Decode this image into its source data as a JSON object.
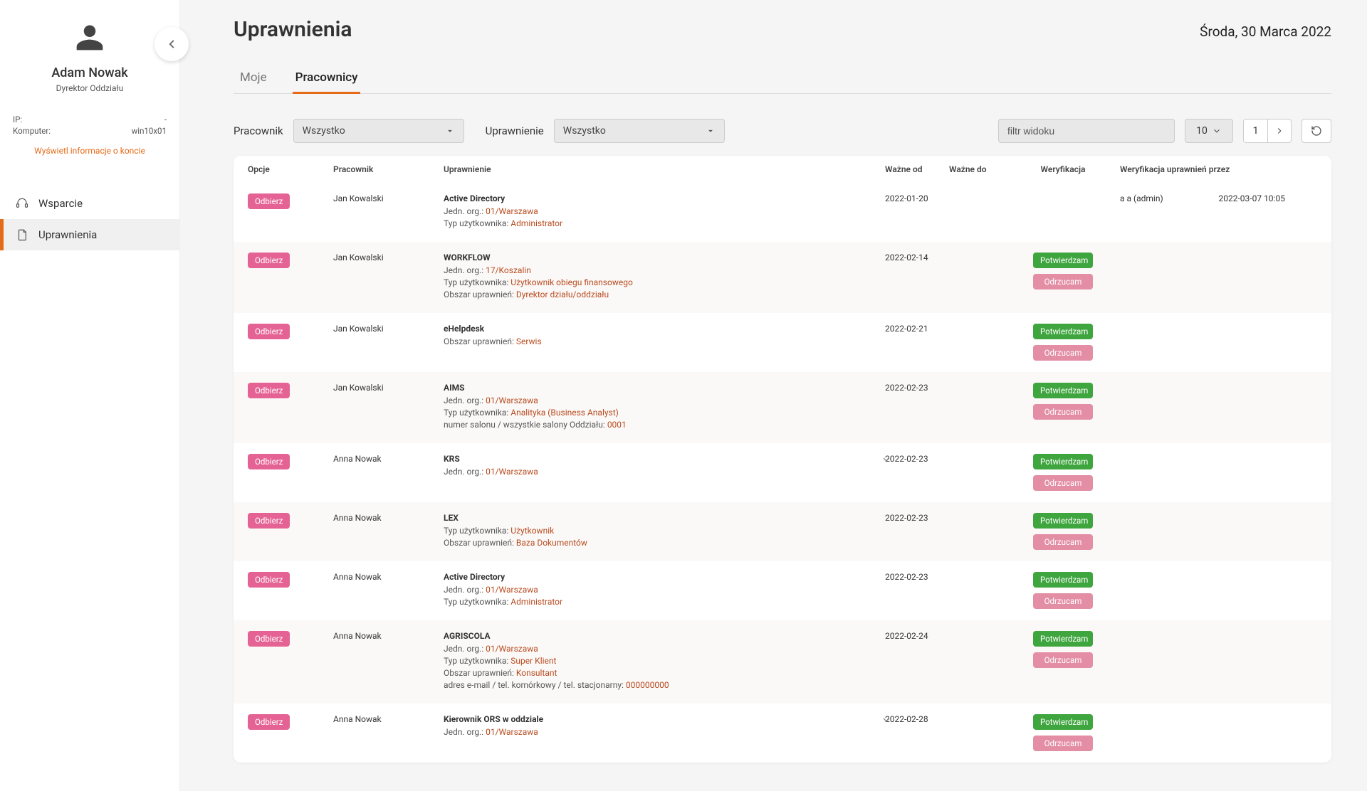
{
  "sidebar": {
    "user_name": "Adam Nowak",
    "user_role": "Dyrektor Oddziału",
    "ip_label": "IP:",
    "ip_value": "-",
    "komp_label": "Komputer:",
    "komp_value": "win10x01",
    "account_link": "Wyświetl informacje o koncie",
    "nav": {
      "support": "Wsparcie",
      "perms": "Uprawnienia"
    }
  },
  "header": {
    "title": "Uprawnienia",
    "date": "Środa, 30 Marca 2022"
  },
  "tabs": {
    "mine": "Moje",
    "employees": "Pracownicy"
  },
  "filters": {
    "employee_label": "Pracownik",
    "employee_value": "Wszystko",
    "perm_label": "Uprawnienie",
    "perm_value": "Wszystko",
    "view_filter_placeholder": "filtr widoku",
    "page_size": "10",
    "page_current": "1"
  },
  "columns": {
    "options": "Opcje",
    "employee": "Pracownik",
    "permission": "Uprawnienie",
    "valid_from": "Ważne od",
    "valid_to": "Ważne do",
    "verification": "Weryfikacja",
    "verified_by": "Weryfikacja uprawnień przez"
  },
  "buttons": {
    "revoke": "Odbierz",
    "confirm": "Potwierdzam",
    "reject": "Odrzucam"
  },
  "perm_labels": {
    "org": "Jedn. org.: ",
    "user_type": "Typ użytkownika: ",
    "scope": "Obszar uprawnień: ",
    "salon": "numer salonu / wszystkie salony Oddziału: ",
    "contact": "adres e-mail / tel. komórkowy / tel. stacjonarny: "
  },
  "rows": [
    {
      "employee": "Jan Kowalski",
      "perm_title": "Active Directory",
      "meta": [
        [
          "org",
          "01/Warszawa"
        ],
        [
          "user_type",
          "Administrator"
        ]
      ],
      "valid_from": "2022-01-20",
      "verified_by": "a a (admin)",
      "verified_at": "2022-03-07 10:05",
      "show_actions": false,
      "expandable": false
    },
    {
      "employee": "Jan Kowalski",
      "perm_title": "WORKFLOW",
      "meta": [
        [
          "org",
          "17/Koszalin"
        ],
        [
          "user_type",
          "Użytkownik obiegu finansowego"
        ],
        [
          "scope",
          "Dyrektor działu/oddziału"
        ]
      ],
      "valid_from": "2022-02-14",
      "show_actions": true,
      "expandable": false
    },
    {
      "employee": "Jan Kowalski",
      "perm_title": "eHelpdesk",
      "meta": [
        [
          "scope",
          "Serwis"
        ]
      ],
      "valid_from": "2022-02-21",
      "show_actions": true,
      "expandable": false
    },
    {
      "employee": "Jan Kowalski",
      "perm_title": "AIMS",
      "meta": [
        [
          "org",
          "01/Warszawa"
        ],
        [
          "user_type",
          "Analityka (Business Analyst)"
        ],
        [
          "salon",
          "0001"
        ]
      ],
      "valid_from": "2022-02-23",
      "show_actions": true,
      "expandable": false
    },
    {
      "employee": "Anna Nowak",
      "perm_title": "KRS",
      "meta": [
        [
          "org",
          "01/Warszawa"
        ]
      ],
      "valid_from": "2022-02-23",
      "show_actions": true,
      "expandable": true
    },
    {
      "employee": "Anna Nowak",
      "perm_title": "LEX",
      "meta": [
        [
          "user_type",
          "Użytkownik"
        ],
        [
          "scope",
          "Baza Dokumentów"
        ]
      ],
      "valid_from": "2022-02-23",
      "show_actions": true,
      "expandable": false
    },
    {
      "employee": "Anna Nowak",
      "perm_title": "Active Directory",
      "meta": [
        [
          "org",
          "01/Warszawa"
        ],
        [
          "user_type",
          "Administrator"
        ]
      ],
      "valid_from": "2022-02-23",
      "show_actions": true,
      "expandable": false
    },
    {
      "employee": "Anna Nowak",
      "perm_title": "AGRISCOLA",
      "meta": [
        [
          "org",
          "01/Warszawa"
        ],
        [
          "user_type",
          "Super Klient"
        ],
        [
          "scope",
          "Konsultant"
        ],
        [
          "contact",
          "000000000"
        ]
      ],
      "valid_from": "2022-02-24",
      "show_actions": true,
      "expandable": false
    },
    {
      "employee": "Anna Nowak",
      "perm_title": "Kierownik ORS w oddziale",
      "meta": [
        [
          "org",
          "01/Warszawa"
        ]
      ],
      "valid_from": "2022-02-28",
      "show_actions": true,
      "expandable": true
    }
  ]
}
